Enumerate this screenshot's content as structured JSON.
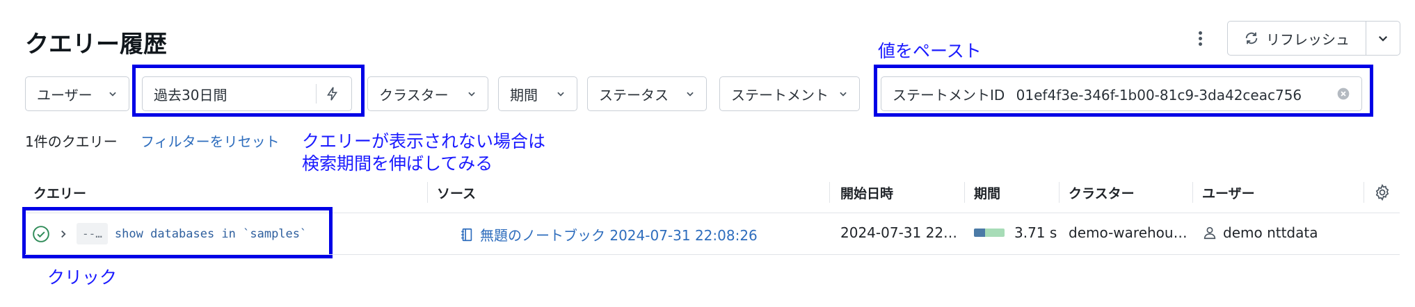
{
  "header": {
    "title": "クエリー履歴",
    "refresh_label": "リフレッシュ"
  },
  "filters": {
    "user": "ユーザー",
    "period_range": "過去30日間",
    "cluster": "クラスター",
    "duration": "期間",
    "status": "ステータス",
    "statement": "ステートメント",
    "statement_id_label": "ステートメントID",
    "statement_id_value": "01ef4f3e-346f-1b00-81c9-3da42ceac756"
  },
  "summary": {
    "count_text": "1件のクエリー",
    "reset_link": "フィルターをリセット"
  },
  "annotations": {
    "paste": "値をペースト",
    "hint_line1": "クエリーが表示されない場合は",
    "hint_line2": "検索期間を伸ばしてみる",
    "click": "クリック"
  },
  "table": {
    "columns": [
      "クエリー",
      "ソース",
      "開始日時",
      "期間",
      "クラスター",
      "ユーザー"
    ],
    "rows": [
      {
        "prefix": "--…",
        "query": "show databases in `samples`",
        "source": "無題のノートブック 2024-07-31 22:08:26",
        "start": "2024-07-31 22…",
        "duration": "3.71 s",
        "duration_fraction": 0.35,
        "cluster": "demo-warehou…",
        "user": "demo nttdata"
      }
    ]
  },
  "colors": {
    "highlight": "#0000e6",
    "annotation": "#1a1aff",
    "link": "#2e6dbd",
    "success": "#2e8b57"
  }
}
